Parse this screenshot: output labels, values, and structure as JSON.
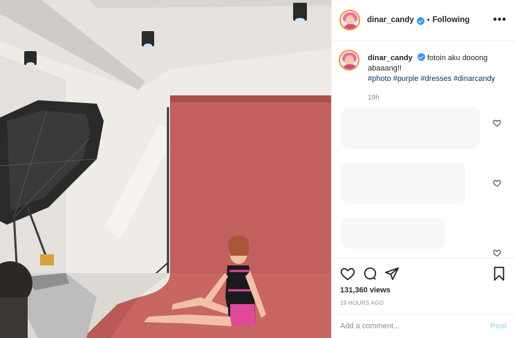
{
  "header": {
    "username": "dinar_candy",
    "separator": "•",
    "follow_status": "Following",
    "more_label": "•••"
  },
  "caption": {
    "username": "dinar_candy",
    "text": "fotoin aku dooong abaaang!!",
    "hashtags": "#photo #purple #dresses #dinarcandy",
    "time": "19h"
  },
  "actions": {
    "icons": [
      "heart-icon",
      "comment-icon",
      "share-icon",
      "bookmark-icon"
    ]
  },
  "stats": {
    "views": "131,360 views",
    "posted": "19 HOURS AGO"
  },
  "comment_box": {
    "placeholder": "Add a comment...",
    "post_label": "Post"
  },
  "colors": {
    "backdrop": "#c1605f",
    "link": "#00376b",
    "verified": "#3897f0",
    "post_disabled": "#b2dffc"
  }
}
